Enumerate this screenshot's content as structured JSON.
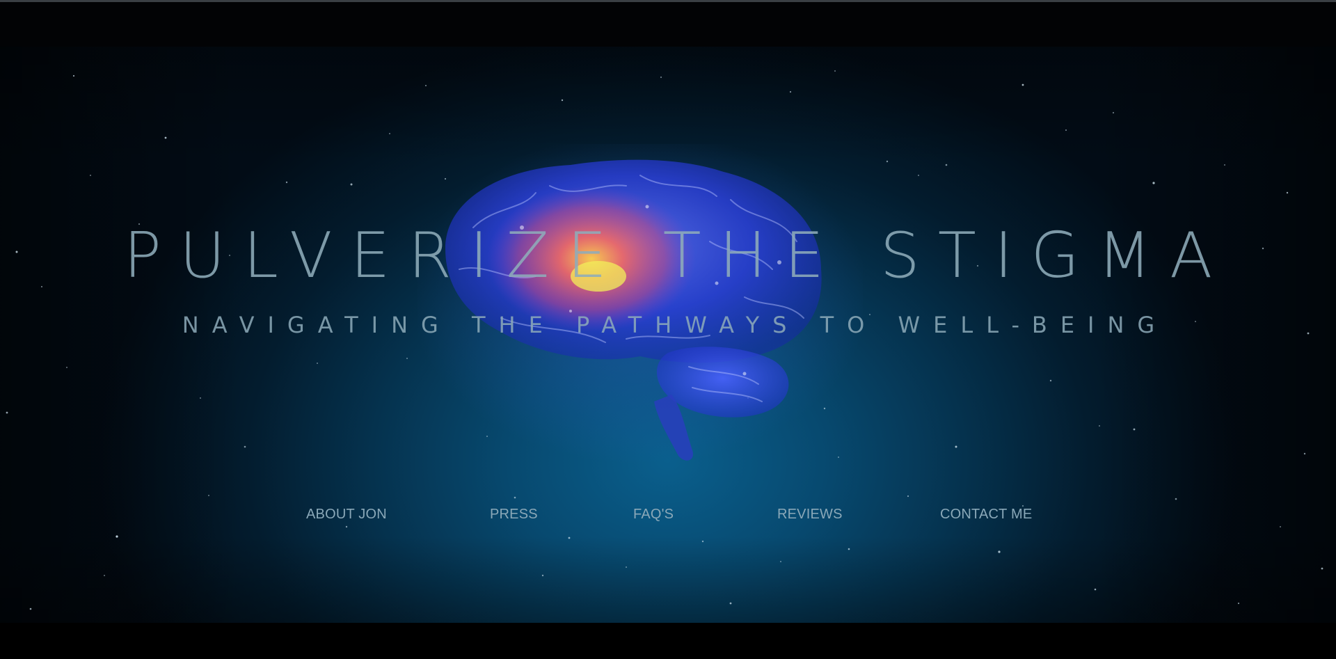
{
  "hero": {
    "title": "PULVERIZE THE STIGMA",
    "subtitle": "NAVIGATING THE PATHWAYS TO WELL-BEING",
    "background_image": "brain-illustration"
  },
  "nav": {
    "items": [
      {
        "label": "ABOUT JON"
      },
      {
        "label": "PRESS"
      },
      {
        "label": "FAQ'S"
      },
      {
        "label": "REVIEWS"
      },
      {
        "label": "CONTACT ME"
      }
    ]
  },
  "colors": {
    "background_center": "#0a5f8d",
    "background_edge": "#020c16",
    "text": "#8eacba",
    "nav_text": "#8aa8b8",
    "frame": "#000000"
  }
}
